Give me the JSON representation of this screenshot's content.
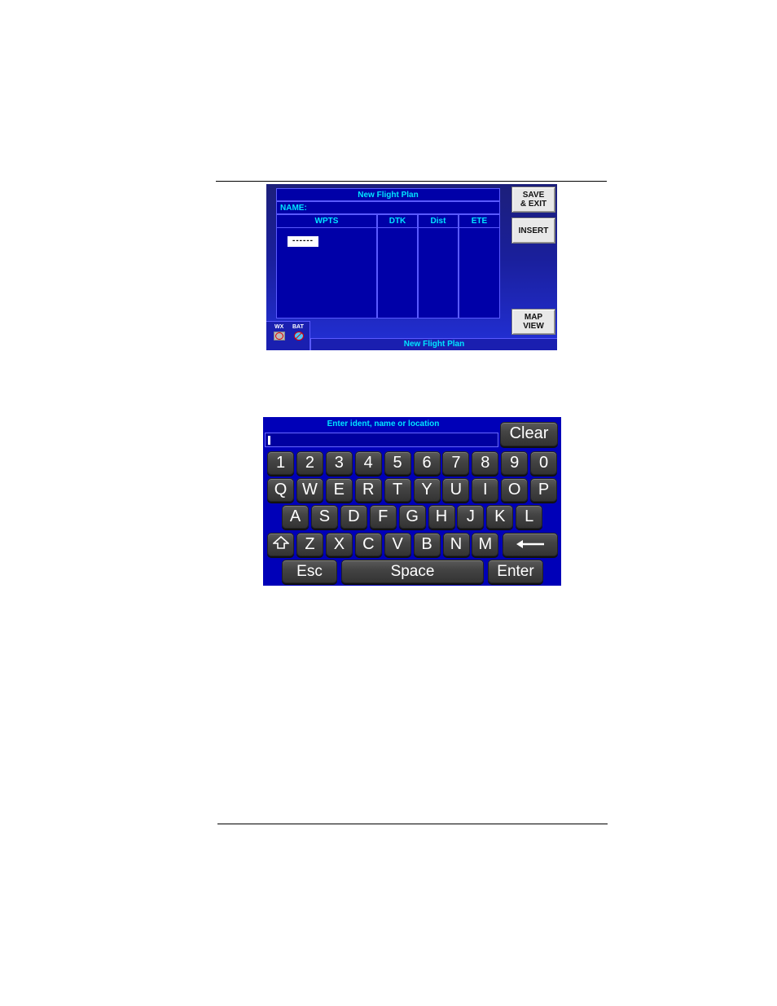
{
  "flight_plan": {
    "title": "New Flight Plan",
    "name_label": "NAME:",
    "columns": [
      "WPTS",
      "DTK",
      "Dist",
      "ETE"
    ],
    "waypoint_entry": "------",
    "buttons": {
      "save_exit": "SAVE & EXIT",
      "insert": "INSERT",
      "map_view": "MAP VIEW"
    },
    "status": {
      "wx_label": "WX",
      "bat_label": "BAT",
      "wx_icon": "wx-disabled-icon",
      "bat_icon": "battery-disabled-icon"
    },
    "footer_title": "New Flight Plan"
  },
  "keyboard": {
    "prompt": "Enter ident, name or location",
    "input_value": "",
    "clear_label": "Clear",
    "row_numbers": [
      "1",
      "2",
      "3",
      "4",
      "5",
      "6",
      "7",
      "8",
      "9",
      "0"
    ],
    "row_top": [
      "Q",
      "W",
      "E",
      "R",
      "T",
      "Y",
      "U",
      "I",
      "O",
      "P"
    ],
    "row_home": [
      "A",
      "S",
      "D",
      "F",
      "G",
      "H",
      "J",
      "K",
      "L"
    ],
    "row_bottom": [
      "Z",
      "X",
      "C",
      "V",
      "B",
      "N",
      "M"
    ],
    "shift_icon": "shift-arrow-icon",
    "backspace_icon": "backspace-arrow-icon",
    "esc_label": "Esc",
    "space_label": "Space",
    "enter_label": "Enter"
  }
}
